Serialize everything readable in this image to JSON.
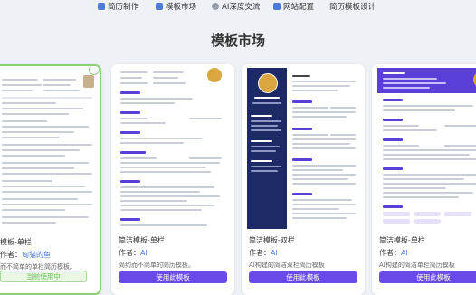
{
  "nav": {
    "items": [
      {
        "label": "简历制作",
        "icon": "resume-icon",
        "color": "#4a7bd8"
      },
      {
        "label": "模板市场",
        "icon": "template-icon",
        "color": "#4a7bd8"
      },
      {
        "label": "AI深度交流",
        "icon": "ai-chat-icon",
        "color": "#9aa0aa"
      },
      {
        "label": "网站配置",
        "icon": "settings-icon",
        "color": "#4a7bd8"
      },
      {
        "label": "简历模板设计",
        "icon": "",
        "color": ""
      }
    ]
  },
  "page_title": "模板市场",
  "cards": [
    {
      "name": "模板-单栏",
      "author_label": "作者：",
      "author": "匈猫的鱼",
      "desc": "而不简单的单栏简历模板。",
      "button": "当前使用中",
      "current": true
    },
    {
      "name": "简洁模板-单栏",
      "author_label": "作者：",
      "author": "AI",
      "desc": "简约而不简单的简历模板。",
      "button": "使用此模板",
      "current": false
    },
    {
      "name": "简洁模板-双栏",
      "author_label": "作者：",
      "author": "AI",
      "desc": "AI构建的简洁双栏简历模板",
      "button": "使用此模板",
      "current": false
    },
    {
      "name": "简洁模板-单栏",
      "author_label": "作者：",
      "author": "AI",
      "desc": "AI构建的简洁单栏简历模板",
      "button": "使用此模板",
      "current": false
    },
    {
      "name": "",
      "author_label": "",
      "author": "",
      "desc": "",
      "button": "",
      "current": false
    }
  ],
  "colors": {
    "accent": "#6a4bea",
    "selected_border": "#8dd07a",
    "navy": "#1e2a66",
    "background": "#eef1f6"
  }
}
